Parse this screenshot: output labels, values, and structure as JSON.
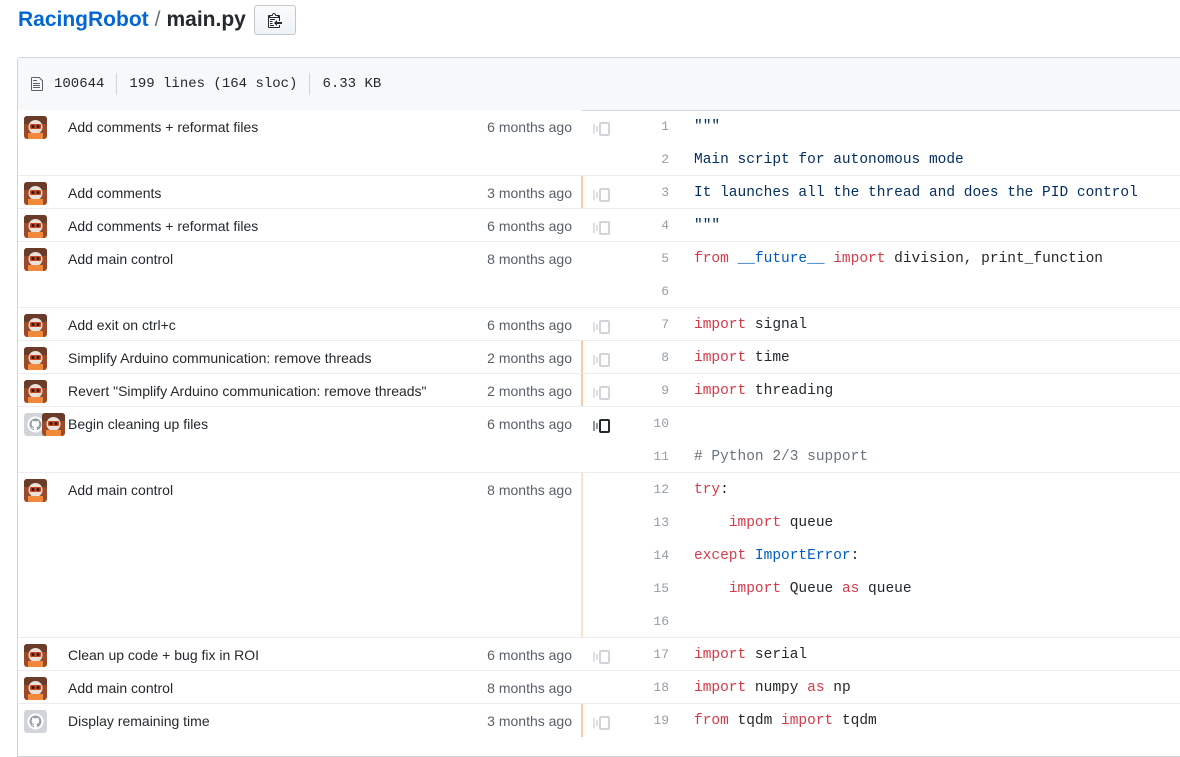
{
  "breadcrumb": {
    "repo": "RacingRobot",
    "separator": "/",
    "file": "main.py",
    "copy_icon": "clippy-icon"
  },
  "file_info": {
    "file_icon": "file-icon",
    "mode": "100644",
    "lines": "199 lines (164 sloc)",
    "size": "6.33 KB"
  },
  "colors": {
    "link": "#0366d6",
    "keyword": "#d73a49",
    "string": "#032f62",
    "comment": "#6a737d",
    "builtin": "#005cc5",
    "age_recent": "#f9c9a1",
    "age_older": "#fce3cd"
  },
  "blame": [
    {
      "message": "Add comments + reformat files",
      "age": "6 months ago",
      "avatar": "robot-avatar",
      "age_color": "none",
      "reblame": true,
      "lines": [
        {
          "n": 1,
          "tokens": [
            {
              "c": "str",
              "t": "\"\"\""
            }
          ]
        },
        {
          "n": 2,
          "tokens": [
            {
              "c": "str",
              "t": "Main script for autonomous mode"
            }
          ]
        }
      ]
    },
    {
      "message": "Add comments",
      "age": "3 months ago",
      "avatar": "robot-avatar",
      "age_color": "recent",
      "reblame": true,
      "lines": [
        {
          "n": 3,
          "tokens": [
            {
              "c": "str",
              "t": "It launches all the thread and does the PID control"
            }
          ]
        }
      ]
    },
    {
      "message": "Add comments + reformat files",
      "age": "6 months ago",
      "avatar": "robot-avatar",
      "age_color": "none",
      "reblame": true,
      "lines": [
        {
          "n": 4,
          "tokens": [
            {
              "c": "str",
              "t": "\"\"\""
            }
          ]
        }
      ]
    },
    {
      "message": "Add main control",
      "age": "8 months ago",
      "avatar": "robot-avatar",
      "age_color": "none",
      "reblame": false,
      "lines": [
        {
          "n": 5,
          "tokens": [
            {
              "c": "kw",
              "t": "from"
            },
            {
              "c": "tx",
              "t": " "
            },
            {
              "c": "bi",
              "t": "__future__"
            },
            {
              "c": "tx",
              "t": " "
            },
            {
              "c": "kw",
              "t": "import"
            },
            {
              "c": "tx",
              "t": " division, print_function"
            }
          ]
        },
        {
          "n": 6,
          "tokens": []
        }
      ]
    },
    {
      "message": "Add exit on ctrl+c",
      "age": "6 months ago",
      "avatar": "robot-avatar",
      "age_color": "none",
      "reblame": true,
      "lines": [
        {
          "n": 7,
          "tokens": [
            {
              "c": "kw",
              "t": "import"
            },
            {
              "c": "tx",
              "t": " signal"
            }
          ]
        }
      ]
    },
    {
      "message": "Simplify Arduino communication: remove threads",
      "age": "2 months ago",
      "avatar": "robot-avatar",
      "age_color": "recent",
      "reblame": true,
      "lines": [
        {
          "n": 8,
          "tokens": [
            {
              "c": "kw",
              "t": "import"
            },
            {
              "c": "tx",
              "t": " time"
            }
          ]
        }
      ]
    },
    {
      "message": "Revert \"Simplify Arduino communication: remove threads\"",
      "age": "2 months ago",
      "avatar": "robot-avatar",
      "age_color": "recent",
      "reblame": true,
      "lines": [
        {
          "n": 9,
          "tokens": [
            {
              "c": "kw",
              "t": "import"
            },
            {
              "c": "tx",
              "t": " threading"
            }
          ]
        }
      ]
    },
    {
      "message": "Begin cleaning up files",
      "age": "6 months ago",
      "avatar": "github-avatar",
      "avatar2": "robot-avatar",
      "age_color": "none",
      "reblame": true,
      "lines": [
        {
          "n": 10,
          "tokens": []
        },
        {
          "n": 11,
          "tokens": [
            {
              "c": "cm",
              "t": "# Python 2/3 support"
            }
          ]
        }
      ]
    },
    {
      "message": "Add main control",
      "age": "8 months ago",
      "avatar": "robot-avatar",
      "age_color": "older",
      "reblame": false,
      "lines": [
        {
          "n": 12,
          "tokens": [
            {
              "c": "kw",
              "t": "try"
            },
            {
              "c": "tx",
              "t": ":"
            }
          ]
        },
        {
          "n": 13,
          "tokens": [
            {
              "c": "tx",
              "t": "    "
            },
            {
              "c": "kw",
              "t": "import"
            },
            {
              "c": "tx",
              "t": " queue"
            }
          ]
        },
        {
          "n": 14,
          "tokens": [
            {
              "c": "kw",
              "t": "except"
            },
            {
              "c": "tx",
              "t": " "
            },
            {
              "c": "bi",
              "t": "ImportError"
            },
            {
              "c": "tx",
              "t": ":"
            }
          ]
        },
        {
          "n": 15,
          "tokens": [
            {
              "c": "tx",
              "t": "    "
            },
            {
              "c": "kw",
              "t": "import"
            },
            {
              "c": "tx",
              "t": " Queue "
            },
            {
              "c": "kw",
              "t": "as"
            },
            {
              "c": "tx",
              "t": " queue"
            }
          ]
        },
        {
          "n": 16,
          "tokens": []
        }
      ]
    },
    {
      "message": "Clean up code + bug fix in ROI",
      "age": "6 months ago",
      "avatar": "robot-avatar",
      "age_color": "none",
      "reblame": true,
      "lines": [
        {
          "n": 17,
          "tokens": [
            {
              "c": "kw",
              "t": "import"
            },
            {
              "c": "tx",
              "t": " serial"
            }
          ]
        }
      ]
    },
    {
      "message": "Add main control",
      "age": "8 months ago",
      "avatar": "robot-avatar",
      "age_color": "none",
      "reblame": false,
      "lines": [
        {
          "n": 18,
          "tokens": [
            {
              "c": "kw",
              "t": "import"
            },
            {
              "c": "tx",
              "t": " numpy "
            },
            {
              "c": "kw",
              "t": "as"
            },
            {
              "c": "tx",
              "t": " np"
            }
          ]
        }
      ]
    },
    {
      "message": "Display remaining time",
      "age": "3 months ago",
      "avatar": "github-avatar",
      "age_color": "recent",
      "reblame": true,
      "lines": [
        {
          "n": 19,
          "tokens": [
            {
              "c": "kw",
              "t": "from"
            },
            {
              "c": "tx",
              "t": " tqdm "
            },
            {
              "c": "kw",
              "t": "import"
            },
            {
              "c": "tx",
              "t": " tqdm"
            }
          ]
        }
      ]
    }
  ]
}
